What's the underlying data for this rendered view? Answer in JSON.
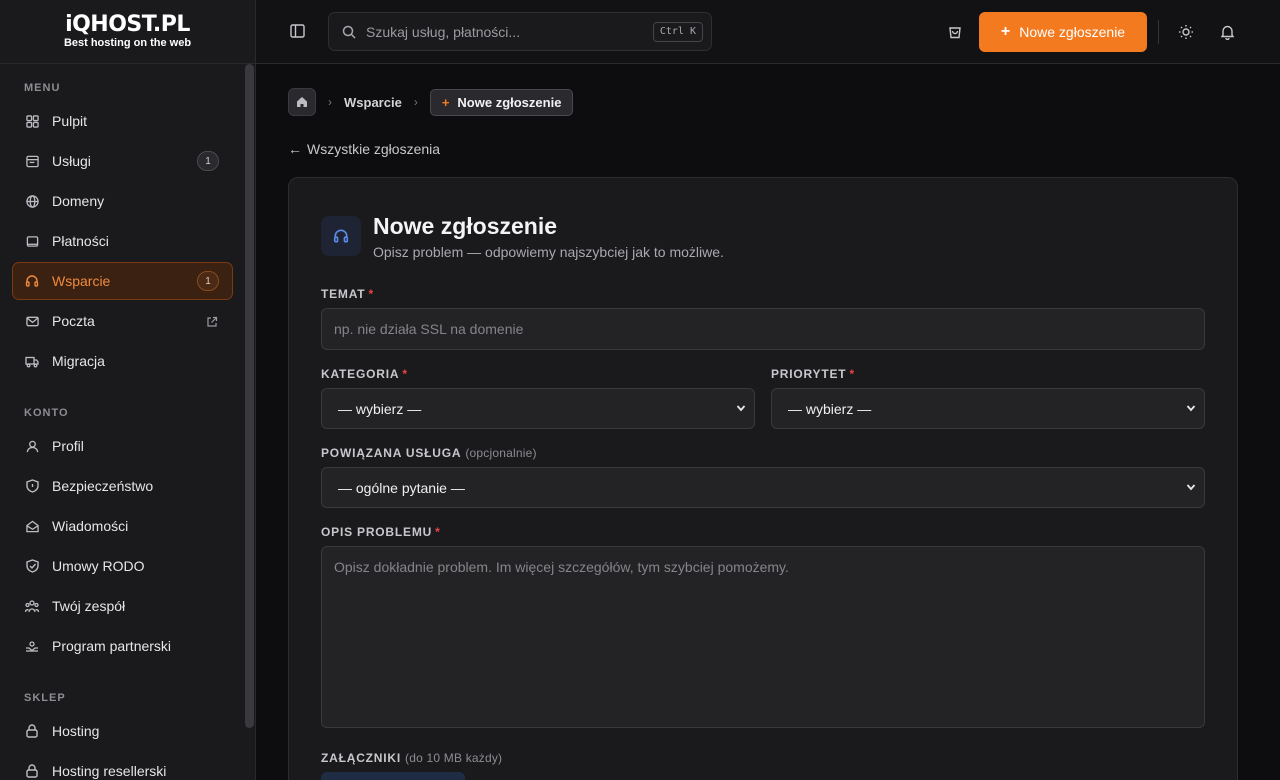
{
  "brand": {
    "name": "iQHOST.PL",
    "tagline": "Best hosting on the web"
  },
  "sidebar": {
    "sections": [
      {
        "title": "MENU",
        "items": [
          {
            "label": "Pulpit",
            "icon": "dashboard-icon"
          },
          {
            "label": "Usługi",
            "icon": "services-icon",
            "badge": "1"
          },
          {
            "label": "Domeny",
            "icon": "globe-icon"
          },
          {
            "label": "Płatności",
            "icon": "wallet-icon"
          },
          {
            "label": "Wsparcie",
            "icon": "headset-icon",
            "badge": "1",
            "active": true
          },
          {
            "label": "Poczta",
            "icon": "mail-icon",
            "external": true
          },
          {
            "label": "Migracja",
            "icon": "truck-icon"
          }
        ]
      },
      {
        "title": "KONTO",
        "items": [
          {
            "label": "Profil",
            "icon": "user-icon"
          },
          {
            "label": "Bezpieczeństwo",
            "icon": "shield-icon"
          },
          {
            "label": "Wiadomości",
            "icon": "envelope-icon"
          },
          {
            "label": "Umowy RODO",
            "icon": "shield-check-icon"
          },
          {
            "label": "Twój zespół",
            "icon": "team-icon"
          },
          {
            "label": "Program partnerski",
            "icon": "handshake-icon"
          }
        ]
      },
      {
        "title": "SKLEP",
        "items": [
          {
            "label": "Hosting",
            "icon": "lock-icon"
          },
          {
            "label": "Hosting resellerski",
            "icon": "lock-icon"
          }
        ]
      }
    ]
  },
  "header": {
    "search_placeholder": "Szukaj usług, płatności...",
    "search_shortcut": "Ctrl K",
    "new_ticket_label": "Nowe zgłoszenie"
  },
  "breadcrumb": {
    "items": [
      "Wsparcie"
    ],
    "current": "Nowe zgłoszenie"
  },
  "back_link": "Wszystkie zgłoszenia",
  "form": {
    "title": "Nowe zgłoszenie",
    "subtitle": "Opisz problem — odpowiemy najszybciej jak to możliwe.",
    "subject": {
      "label": "TEMAT",
      "placeholder": "np. nie działa SSL na domenie",
      "value": ""
    },
    "category": {
      "label": "KATEGORIA",
      "value": "— wybierz —"
    },
    "priority": {
      "label": "PRIORYTET",
      "value": "— wybierz —"
    },
    "service": {
      "label": "POWIĄZANA USŁUGA",
      "optional": "(opcjonalnie)",
      "value": "— ogólne pytanie —"
    },
    "description": {
      "label": "OPIS PROBLEMU",
      "placeholder": "Opisz dokładnie problem. Im więcej szczegółów, tym szybciej pomożemy.",
      "value": ""
    },
    "attachments": {
      "label": "ZAŁĄCZNIKI",
      "hint": "(do 10 MB każdy)"
    },
    "required_mark": "*"
  },
  "colors": {
    "accent": "#f47a1f",
    "active_bg": "#3a2112",
    "danger": "#ef4444",
    "icon_blue": "#5b8ee8"
  }
}
